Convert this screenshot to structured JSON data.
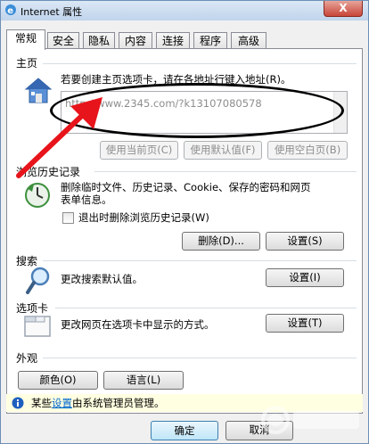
{
  "window": {
    "title": "Internet 属性",
    "close_label": "X"
  },
  "tabs": [
    "常规",
    "安全",
    "隐私",
    "内容",
    "连接",
    "程序",
    "高级"
  ],
  "homepage": {
    "section_title": "主页",
    "instruction": "若要创建主页选项卡，请在各地址行键入地址(R)。",
    "url_value": "http://www.2345.com/?k13107080578",
    "btn_use_current": "使用当前页(C)",
    "btn_use_default": "使用默认值(F)",
    "btn_use_blank": "使用空白页(B)"
  },
  "history": {
    "section_title": "浏览历史记录",
    "description_line1": "删除临时文件、历史记录、Cookie、保存的密码和网页",
    "description_line2": "表单信息。",
    "checkbox_label": "退出时删除浏览历史记录(W)",
    "btn_delete": "删除(D)...",
    "btn_settings": "设置(S)"
  },
  "search": {
    "section_title": "搜索",
    "description": "更改搜索默认值。",
    "btn_settings": "设置(I)"
  },
  "tabs_section": {
    "section_title": "选项卡",
    "description": "更改网页在选项卡中显示的方式。",
    "btn_settings": "设置(T)"
  },
  "appearance": {
    "section_title": "外观",
    "btn_colors": "颜色(O)",
    "btn_languages": "语言(L)"
  },
  "infobar": {
    "prefix": "某些",
    "link": "设置",
    "suffix": "由系统管理员管理。"
  },
  "footer": {
    "ok": "确定",
    "cancel": "取消"
  },
  "colors": {
    "annotation_arrow": "#e8141b",
    "annotation_ellipse": "#000000",
    "link": "#0066cc",
    "infobar_bg": "#ffffe1"
  },
  "icons": {
    "homepage": "house-icon",
    "history": "clock-delete-icon",
    "search": "magnifier-icon",
    "tabs": "tabs-window-icon",
    "info": "info-icon"
  }
}
